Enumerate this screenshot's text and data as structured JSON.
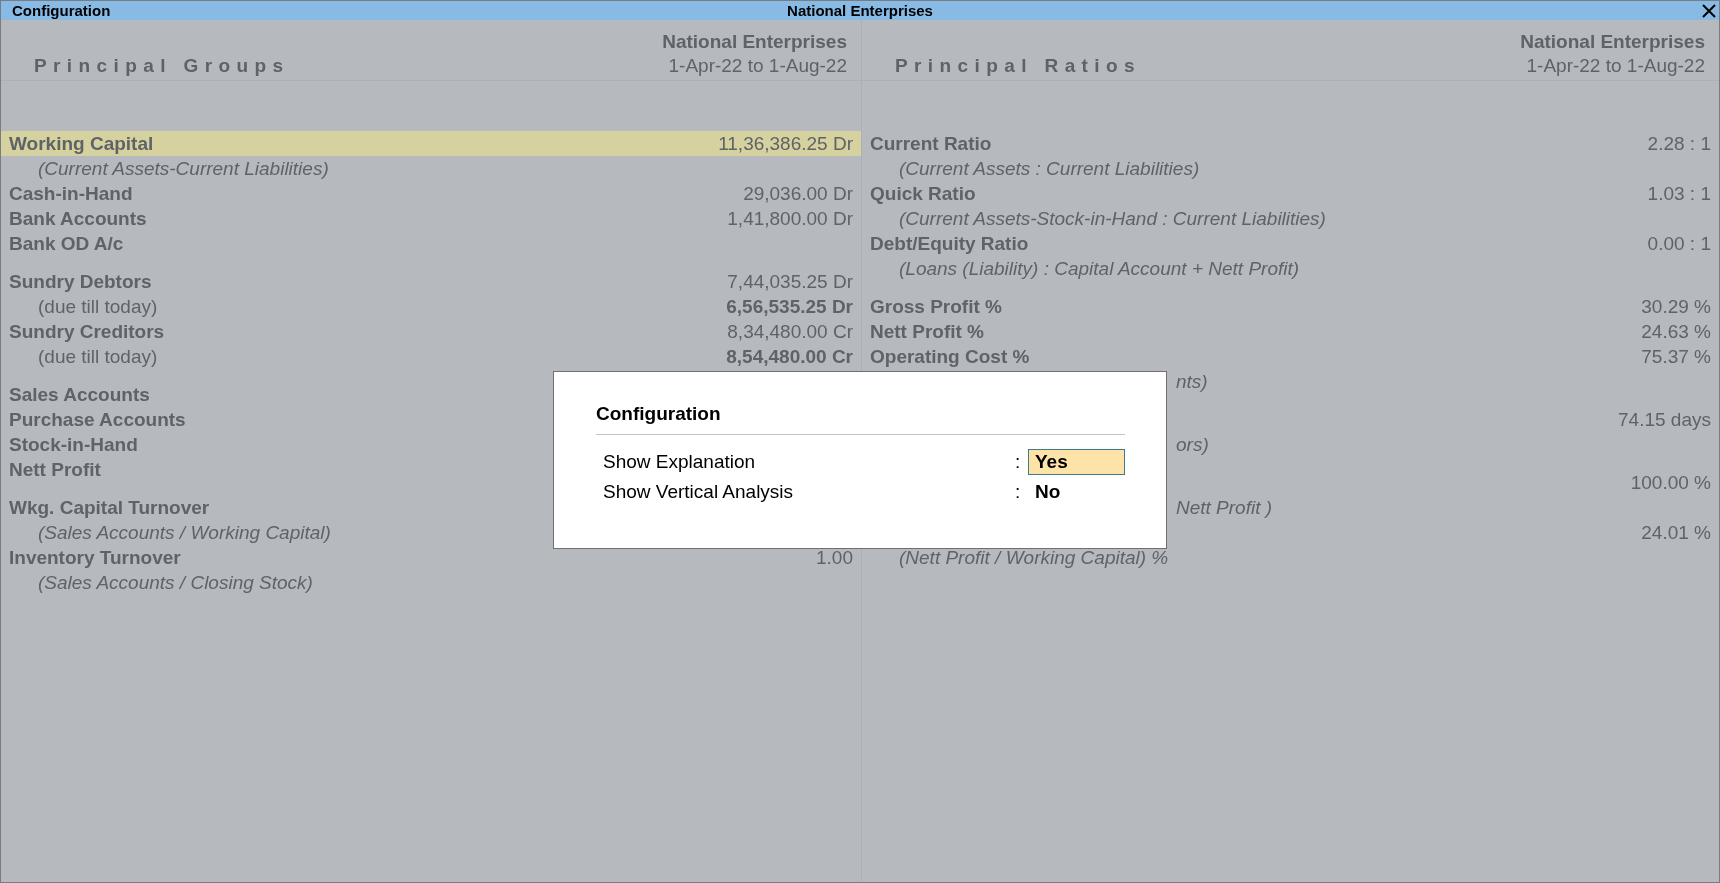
{
  "title_bar": {
    "title": "Configuration",
    "company": "National Enterprises"
  },
  "panels": [
    {
      "heading": "Principal Groups",
      "company": "National Enterprises",
      "period": "1-Apr-22 to 1-Aug-22",
      "groups": [
        [
          {
            "kind": "item",
            "label": "Working Capital",
            "value": "11,36,386.25 Dr",
            "selected": true
          },
          {
            "kind": "note",
            "label": "(Current Assets-Current Liabilities)"
          },
          {
            "kind": "item",
            "label": "Cash-in-Hand",
            "value": "29,036.00 Dr",
            "selected": false
          },
          {
            "kind": "item",
            "label": "Bank Accounts",
            "value": "1,41,800.00 Dr",
            "selected": false
          },
          {
            "kind": "item",
            "label": "Bank OD A/c",
            "selected": false
          }
        ],
        [
          {
            "kind": "item",
            "label": "Sundry Debtors",
            "value": "7,44,035.25 Dr",
            "selected": false
          },
          {
            "kind": "sub",
            "label": "(due till today)",
            "value": "6,56,535.25 Dr"
          },
          {
            "kind": "item",
            "label": "Sundry Creditors",
            "value": "8,34,480.00 Cr",
            "selected": false
          },
          {
            "kind": "sub",
            "label": "(due till today)",
            "value": "8,54,480.00 Cr"
          }
        ],
        [
          {
            "kind": "item",
            "label": "Sales Accounts",
            "selected": false
          },
          {
            "kind": "item",
            "label": "Purchase Accounts",
            "selected": false
          },
          {
            "kind": "item",
            "label": "Stock-in-Hand",
            "selected": false
          },
          {
            "kind": "item",
            "label": "Nett Profit",
            "selected": false
          }
        ],
        [
          {
            "kind": "item",
            "label": "Wkg. Capital Turnover",
            "selected": false
          },
          {
            "kind": "note",
            "label": "(Sales Accounts / Working Capital)"
          },
          {
            "kind": "item",
            "label": "Inventory Turnover",
            "value": "1.00",
            "selected": false
          },
          {
            "kind": "note",
            "label": "(Sales Accounts / Closing Stock)"
          }
        ]
      ]
    },
    {
      "heading": "Principal Ratios",
      "company": "National Enterprises",
      "period": "1-Apr-22 to 1-Aug-22",
      "groups": [
        [
          {
            "kind": "item",
            "label": "Current Ratio",
            "value": "2.28 : 1",
            "selected": false
          },
          {
            "kind": "note",
            "label": "(Current Assets : Current Liabilities)"
          },
          {
            "kind": "item",
            "label": "Quick Ratio",
            "value": "1.03 : 1",
            "selected": false
          },
          {
            "kind": "note",
            "label": "(Current Assets-Stock-in-Hand : Current Liabilities)"
          },
          {
            "kind": "item",
            "label": "Debt/Equity Ratio",
            "value": "0.00 : 1",
            "selected": false
          },
          {
            "kind": "note",
            "label": "(Loans (Liability) : Capital Account + Nett Profit)"
          }
        ],
        [
          {
            "kind": "item",
            "label": "Gross Profit %",
            "value": "30.29 %",
            "selected": false
          },
          {
            "kind": "item",
            "label": "Nett Profit %",
            "value": "24.63 %",
            "selected": false
          },
          {
            "kind": "item",
            "label": "Operating Cost %",
            "value": "75.37 %",
            "selected": false
          },
          {
            "kind": "fragment",
            "label": "nts)"
          }
        ],
        [
          {
            "kind": "item",
            "value": "74.15 days",
            "selected": false
          },
          {
            "kind": "fragment",
            "label": "ors)"
          }
        ],
        [
          {
            "kind": "item",
            "value": "100.00 %",
            "selected": false
          },
          {
            "kind": "fragment",
            "label": "Nett Profit )"
          },
          {
            "kind": "item",
            "value": "24.01 %",
            "selected": false
          },
          {
            "kind": "note",
            "label": "(Nett Profit / Working Capital) %"
          }
        ]
      ]
    }
  ],
  "dialog": {
    "title": "Configuration",
    "fields": [
      {
        "label": "Show Explanation",
        "separator": ":",
        "value": "Yes",
        "selected": true
      },
      {
        "label": "Show Vertical Analysis",
        "separator": ":",
        "value": "No",
        "selected": false
      }
    ]
  }
}
